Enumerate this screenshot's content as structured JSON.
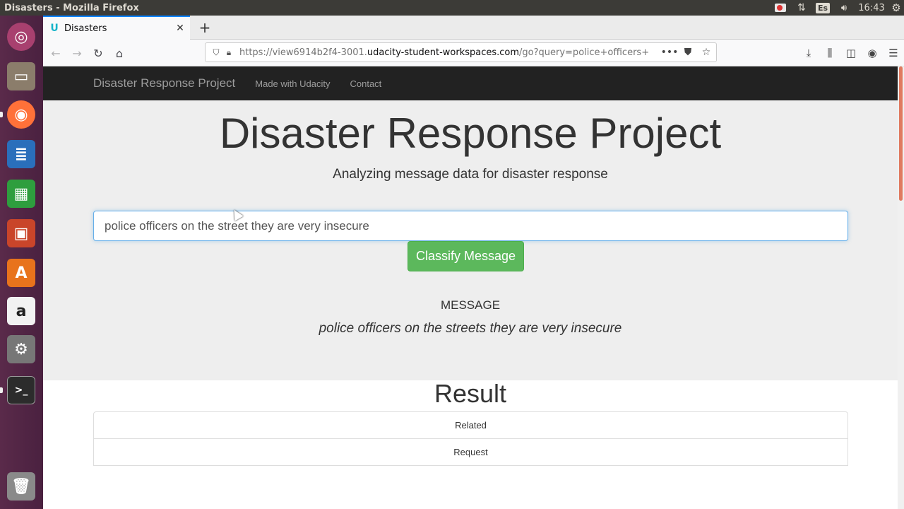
{
  "os": {
    "window_title": "Disasters - Mozilla Firefox",
    "keyboard_layout": "Es",
    "clock": "16:43"
  },
  "launcher": {
    "items": [
      {
        "name": "ubuntu-dash-icon",
        "color": "#e95420"
      },
      {
        "name": "files-icon",
        "color": "#8b7d6b"
      },
      {
        "name": "firefox-icon",
        "color": "#ff7139"
      },
      {
        "name": "libreoffice-writer-icon",
        "color": "#2a6fbb"
      },
      {
        "name": "libreoffice-calc-icon",
        "color": "#2e9e3e"
      },
      {
        "name": "libreoffice-impress-icon",
        "color": "#c9452a"
      },
      {
        "name": "ubuntu-software-icon",
        "color": "#e8731c"
      },
      {
        "name": "amazon-icon",
        "color": "#2b2b2b"
      },
      {
        "name": "system-settings-icon",
        "color": "#777777"
      },
      {
        "name": "terminal-icon",
        "color": "#2c2c2c"
      },
      {
        "name": "trash-icon",
        "color": "#8a8a8a"
      }
    ]
  },
  "browser": {
    "tab_title": "Disasters",
    "url_prefix": "https://view6914b2f4-3001.",
    "url_domain": "udacity-student-workspaces.com",
    "url_suffix": "/go?query=police+officers+"
  },
  "site": {
    "brand": "Disaster Response Project",
    "nav_links": [
      "Made with Udacity",
      "Contact"
    ],
    "heading": "Disaster Response Project",
    "subheading": "Analyzing message data for disaster response",
    "query_value": "police officers on the street they are very insecure",
    "classify_label": "Classify Message",
    "message_label": "MESSAGE",
    "message_text": "police officers on the streets they are very insecure",
    "result_title": "Result",
    "results": [
      "Related",
      "Request"
    ]
  },
  "colors": {
    "navbar_bg": "#222222",
    "jumbotron_bg": "#eeeeee",
    "classify_button": "#5cb85c",
    "input_focus": "#66afe9"
  }
}
